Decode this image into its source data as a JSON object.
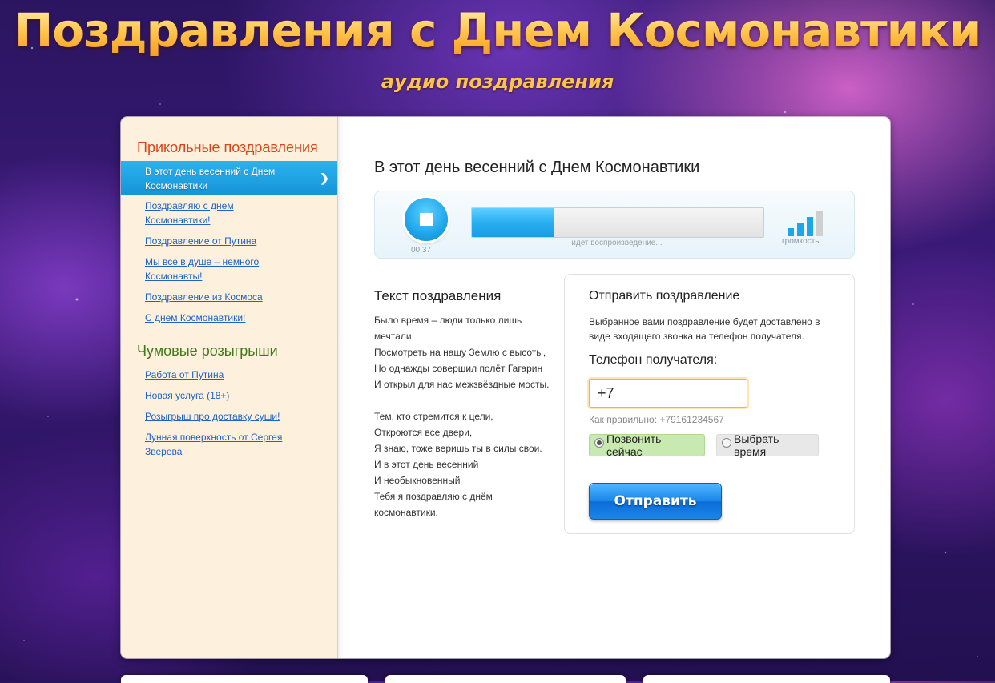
{
  "header": {
    "title": "Поздравления с Днем Космонавтики",
    "subtitle": "аудио поздравления"
  },
  "sidebar": {
    "sections": [
      {
        "heading": "Прикольные поздравления",
        "items": [
          {
            "label": "В этот день весенний с Днем Космонавтики",
            "active": true
          },
          {
            "label": "Поздравляю с днем Космонавтики!"
          },
          {
            "label": "Поздравление от Путина"
          },
          {
            "label": "Мы все в душе – немного Космонавты!"
          },
          {
            "label": "Поздравление из Космоса"
          },
          {
            "label": "С днем Космонавтики!"
          }
        ]
      },
      {
        "heading": "Чумовые розыгрыши",
        "items": [
          {
            "label": "Работа от Путина"
          },
          {
            "label": "Новая услуга (18+)"
          },
          {
            "label": "Розыгрыш про доставку суши!"
          },
          {
            "label": "Лунная поверхность от Сергея Зверева"
          }
        ]
      }
    ],
    "active_arrow_icon": "chevron-right-icon"
  },
  "song": {
    "title": "В этот день весенний с Днем Космонавтики"
  },
  "player": {
    "stop_icon": "stop-icon",
    "time": "00:37",
    "progress_fraction": 0.28,
    "status": "идет воспроизведение...",
    "volume_label": "громкость",
    "volume_level_bars": 3,
    "volume_total_bars": 4,
    "accent_color": "#1ea6ea"
  },
  "lyrics": {
    "title": "Текст поздравления",
    "stanza1": {
      "l1": "Было время – люди только лишь мечтали",
      "l2": "Посмотреть на нашу Землю с высоты,",
      "l3": "Но однажды совершил полёт Гагарин",
      "l4": "И открыл для нас межзвёздные мосты."
    },
    "stanza2": {
      "l1": "Тем, кто стремится к цели,",
      "l2": "Откроются все двери,",
      "l3": "Я знаю, тоже веришь ты в силы свои.",
      "l4": "И в этот день весенний",
      "l5": "И необыкновенный",
      "l6": "Тебя я поздравляю с днём космонавтики."
    }
  },
  "send": {
    "title": "Отправить поздравление",
    "description": "Выбранное вами поздравление будет доставлено в виде входящего звонка на телефон получателя.",
    "phone_label": "Телефон получателя:",
    "phone_value": "+7",
    "phone_hint": "Как правильно: +79161234567",
    "option_now": "Позвонить сейчас",
    "option_schedule": "Выбрать время",
    "selected_option": "now",
    "submit_label": "Отправить"
  }
}
